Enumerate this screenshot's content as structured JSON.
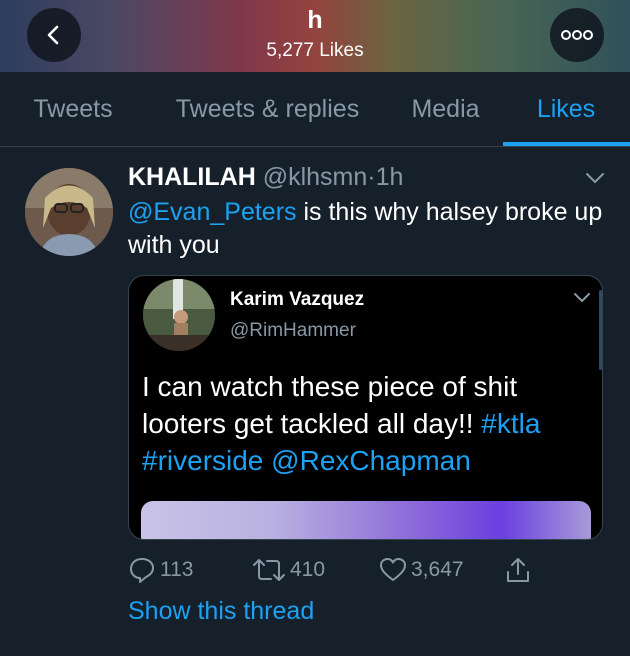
{
  "header": {
    "title": "h",
    "subtitle": "5,277 Likes",
    "back_icon": "chevron-left-icon",
    "more_icon": "more-horizontal-icon"
  },
  "tabs": [
    {
      "label": "Tweets",
      "active": false
    },
    {
      "label": "Tweets & replies",
      "active": false
    },
    {
      "label": "Media",
      "active": false
    },
    {
      "label": "Likes",
      "active": true
    }
  ],
  "tweet": {
    "name": "KHALILAH",
    "handle": "@klhsmn",
    "separator": "·",
    "time": "1h",
    "mention": "@Evan_Peters",
    "text": " is this why halsey broke up with you",
    "quote": {
      "name": "Karim Vazquez",
      "handle": "@RimHammer",
      "text_plain": "I can watch these piece of shit looters get tackled all day!! ",
      "hashtag1": "#ktla",
      "hashtag2": "#riverside",
      "mention": "@RexChapman"
    },
    "actions": {
      "replies": "113",
      "retweets": "410",
      "likes": "3,647"
    },
    "show_thread": "Show this thread"
  },
  "colors": {
    "background": "#15202b",
    "accent": "#1da1f2",
    "secondary_text": "#8899a6",
    "divider": "#38444d"
  }
}
